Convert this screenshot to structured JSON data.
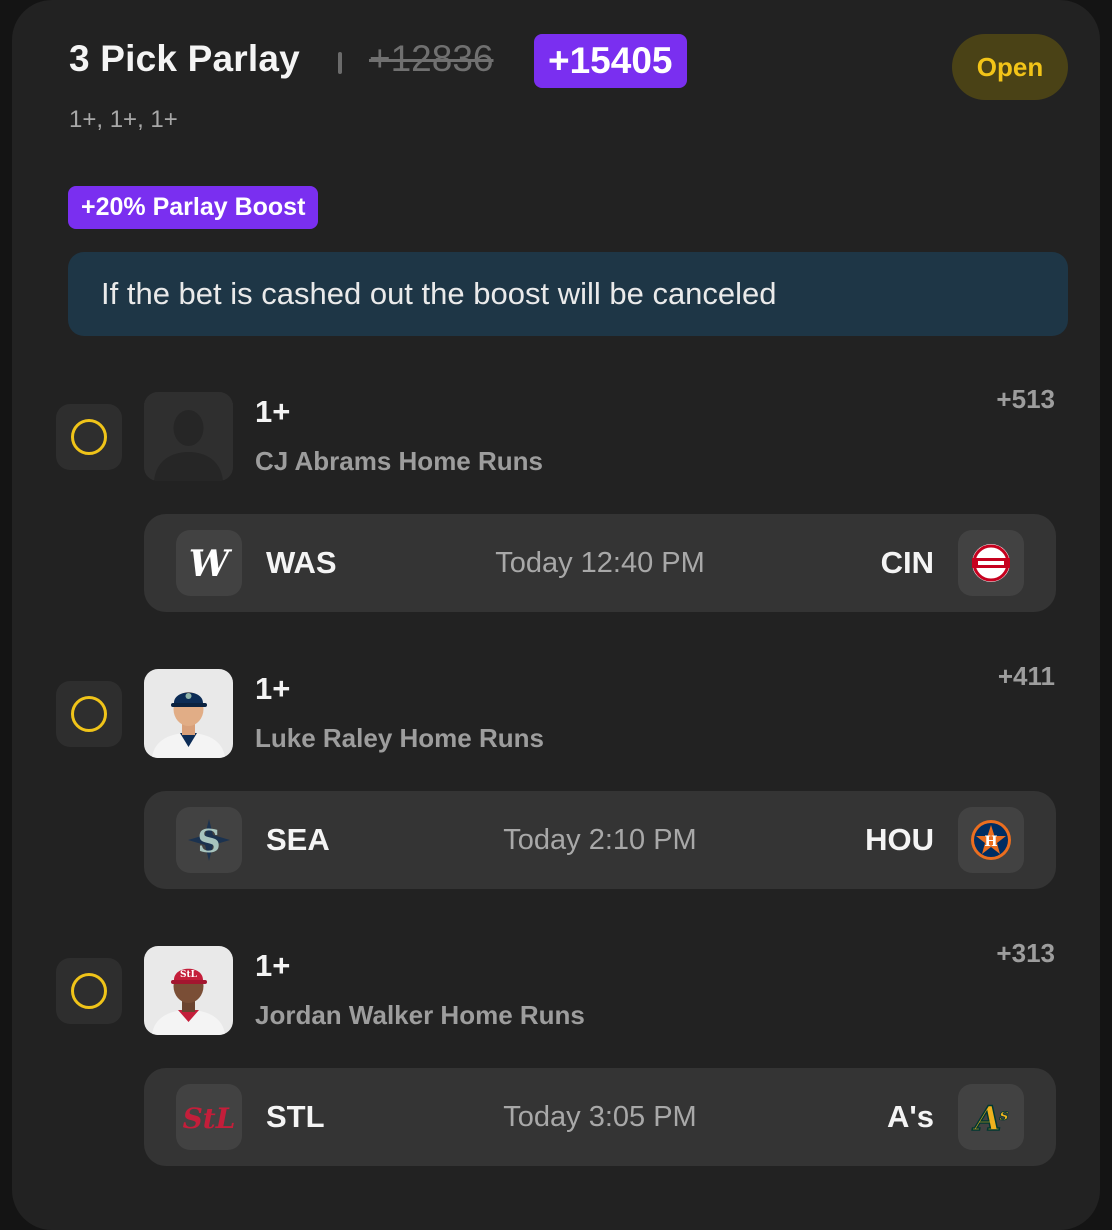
{
  "header": {
    "title": "3 Pick Parlay",
    "original_odds": "+12836",
    "boosted_odds": "+15405",
    "status": "Open",
    "subtitle": "1+, 1+, 1+"
  },
  "boost": {
    "badge": "+20% Parlay Boost",
    "notice": "If the bet is cashed out the boost will be canceled"
  },
  "colors": {
    "accent_purple": "#7a2ff0",
    "status_yellow": "#f2c418",
    "notice_bg": "#1e3646"
  },
  "picks": [
    {
      "line": "1+",
      "market": "CJ Abrams Home Runs",
      "odds": "+513",
      "avatar": "placeholder-person-icon",
      "game": {
        "away_abbr": "WAS",
        "away_logo": "nationals-logo-icon",
        "time": "Today 12:40 PM",
        "home_abbr": "CIN",
        "home_logo": "reds-logo-icon"
      }
    },
    {
      "line": "1+",
      "market": "Luke Raley Home Runs",
      "odds": "+411",
      "avatar": "player-photo",
      "game": {
        "away_abbr": "SEA",
        "away_logo": "mariners-logo-icon",
        "time": "Today 2:10 PM",
        "home_abbr": "HOU",
        "home_logo": "astros-logo-icon"
      }
    },
    {
      "line": "1+",
      "market": "Jordan Walker Home Runs",
      "odds": "+313",
      "avatar": "player-photo",
      "game": {
        "away_abbr": "STL",
        "away_logo": "cardinals-logo-icon",
        "time": "Today 3:05 PM",
        "home_abbr": "A's",
        "home_logo": "athletics-logo-icon"
      }
    }
  ]
}
